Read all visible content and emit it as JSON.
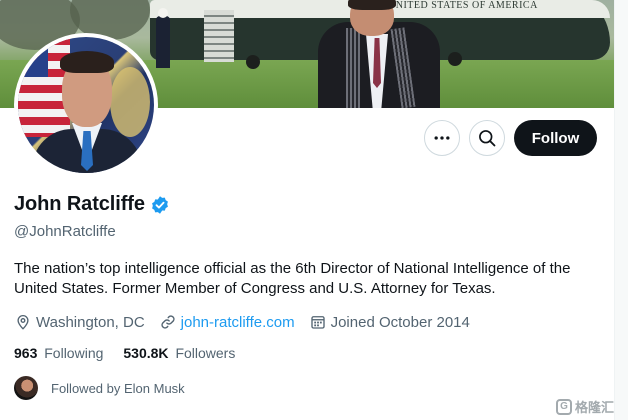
{
  "banner": {
    "helicopter_text": "UNITED STATES OF AMERICA"
  },
  "actions": {
    "more_icon": "more-horizontal-icon",
    "search_icon": "search-icon",
    "follow_label": "Follow"
  },
  "profile": {
    "name": "John Ratcliffe",
    "verified_icon": "verified-badge-icon",
    "handle": "@JohnRatcliffe",
    "bio": "The nation’s top intelligence official as the 6th Director of National Intelligence of the United States. Former Member of Congress and U.S. Attorney for Texas.",
    "location": "Washington, DC",
    "website": "john-ratcliffe.com",
    "joined": "Joined October 2014",
    "following_count": "963",
    "following_label": "Following",
    "followers_count": "530.8K",
    "followers_label": "Followers",
    "followed_by": "Followed by Elon Musk"
  },
  "watermark": {
    "text": "格隆汇"
  },
  "colors": {
    "accent": "#1d9bf0",
    "follow_button": "#0f1419",
    "secondary_text": "#536471"
  }
}
